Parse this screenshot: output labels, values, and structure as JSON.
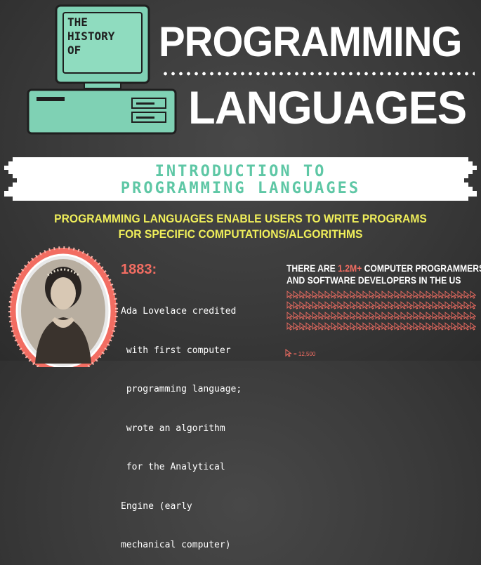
{
  "header": {
    "small_title_lines": [
      "THE",
      "HISTORY",
      "OF"
    ],
    "title_line1": "PROGRAMMING",
    "title_line2": "LANGUAGES"
  },
  "banner": {
    "line1": "INTRODUCTION TO",
    "line2": "PROGRAMMING LANGUAGES"
  },
  "intro": {
    "text": "PROGRAMMING LANGUAGES ENABLE USERS TO WRITE PROGRAMS FOR SPECIFIC COMPUTATIONS/ALGORITHMS"
  },
  "timeline": {
    "year": "1883:",
    "description_lines": [
      "Ada Lovelace credited",
      " with first computer",
      " programming language;",
      " wrote an algorithm",
      " for the Analytical",
      "Engine (early",
      "mechanical computer)"
    ]
  },
  "stats": {
    "prefix": "THERE ARE ",
    "highlight": "1.2M+",
    "suffix_line1": " COMPUTER PROGRAMMERS",
    "line2": "AND SOFTWARE DEVELOPERS IN THE US",
    "legend": "= 12,500",
    "icon": "cursor-arrow-icon"
  },
  "colors": {
    "accent_teal": "#7fd1b4",
    "accent_red": "#f26d62",
    "accent_yellow": "#f0ef5a",
    "background": "#3a3a3a"
  }
}
